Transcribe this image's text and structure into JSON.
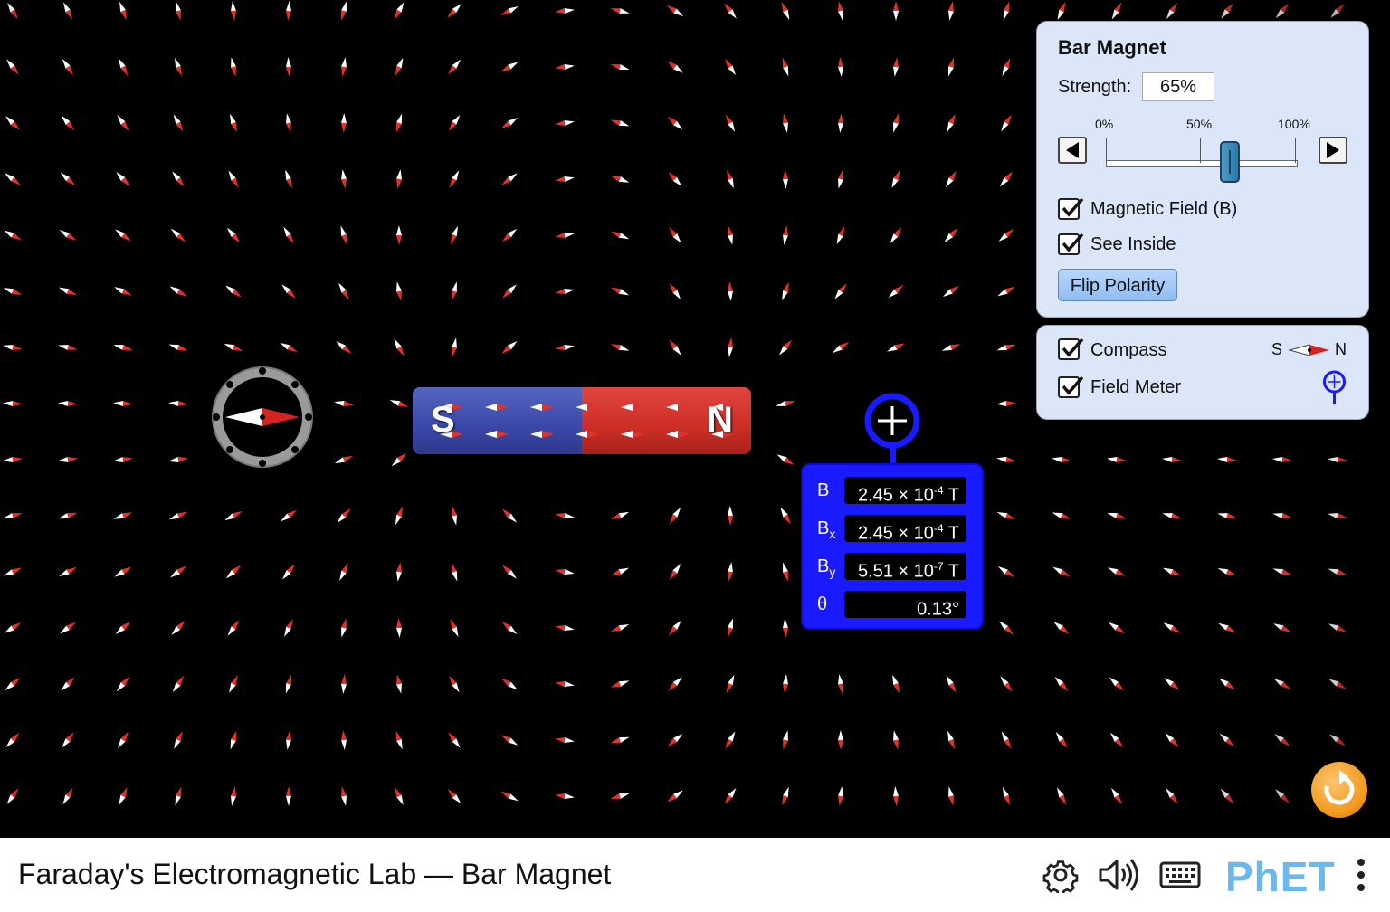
{
  "app": {
    "title": "Faraday's Electromagnetic Lab — Bar Magnet"
  },
  "magnet": {
    "south_label": "S",
    "north_label": "N"
  },
  "field_meter": {
    "rows": [
      {
        "label": "B",
        "sub": "",
        "mantissa": "2.45 × 10",
        "exp": "-4",
        "unit": " T"
      },
      {
        "label": "B",
        "sub": "x",
        "mantissa": "2.45 × 10",
        "exp": "-4",
        "unit": " T"
      },
      {
        "label": "B",
        "sub": "y",
        "mantissa": "5.51 × 10",
        "exp": "-7",
        "unit": " T"
      },
      {
        "label": "θ",
        "sub": "",
        "mantissa": "0.13°",
        "exp": "",
        "unit": ""
      }
    ]
  },
  "bar_magnet_panel": {
    "title": "Bar Magnet",
    "strength_label": "Strength:",
    "strength_value": "65%",
    "strength_fraction": 0.65,
    "ticks": [
      "0%",
      "50%",
      "100%"
    ],
    "magnetic_field_label": "Magnetic Field (B)",
    "magnetic_field_checked": true,
    "see_inside_label": "See Inside",
    "see_inside_checked": true,
    "flip_label": "Flip Polarity"
  },
  "tools_panel": {
    "compass_label": "Compass",
    "compass_checked": true,
    "compass_icon_s": "S",
    "compass_icon_n": "N",
    "field_meter_label": "Field Meter",
    "field_meter_checked": true
  },
  "navbar": {
    "logo": "PhET",
    "icons": [
      "gear-icon",
      "speaker-icon",
      "keyboard-icon",
      "kebab-menu-icon"
    ]
  },
  "colors": {
    "north": "#cc2e26",
    "south": "#3a47a8",
    "meter": "#1a1aff",
    "panel": "#dbe6f8",
    "reset": "#f29a1c"
  }
}
